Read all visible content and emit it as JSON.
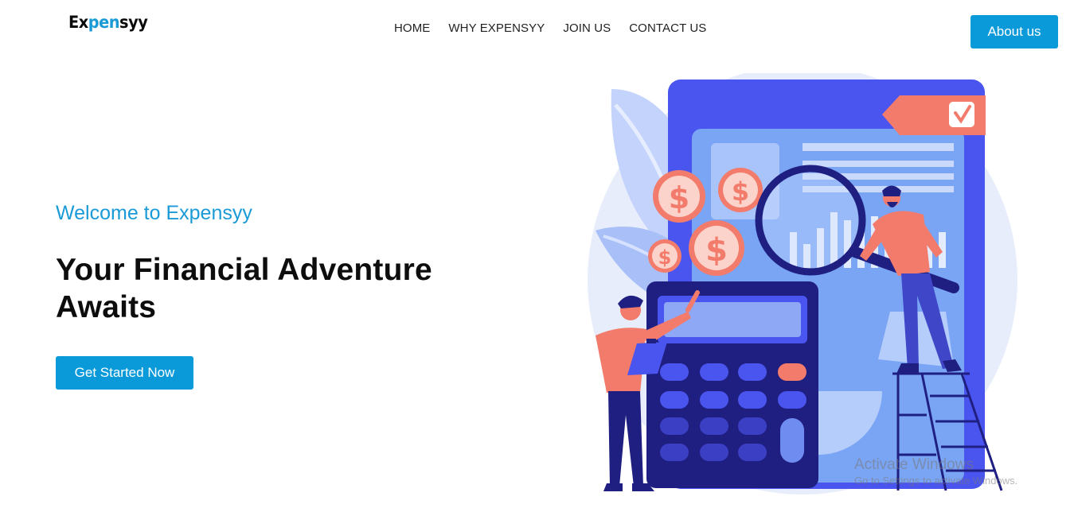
{
  "brand": {
    "logo_part1": "Ex",
    "logo_part2": "pen",
    "logo_part3": "syy"
  },
  "nav": {
    "items": [
      {
        "label": "HOME"
      },
      {
        "label": "WHY EXPENSYY"
      },
      {
        "label": "JOIN US"
      },
      {
        "label": "CONTACT US"
      }
    ],
    "about_label": "About us"
  },
  "hero": {
    "welcome": "Welcome to Expensyy",
    "headline_line1": "Your Financial Adventure",
    "headline_line2": "Awaits",
    "cta_label": "Get Started Now"
  },
  "illustration": {
    "coin_symbol": "$",
    "icons": [
      "calculator-icon",
      "magnifying-glass-icon",
      "checkmark-icon",
      "coin-icon",
      "person-icon",
      "ladder-icon",
      "leaf-icon"
    ]
  },
  "watermark": {
    "title": "Activate Windows",
    "subtitle": "Go to Settings to activate Windows."
  },
  "colors": {
    "accent": "#0b9ad9",
    "logo_accent": "#1a9ad6",
    "illustration_blue": "#4a55f0",
    "illustration_coral": "#f27b6b",
    "illustration_navy": "#1f1f82"
  }
}
